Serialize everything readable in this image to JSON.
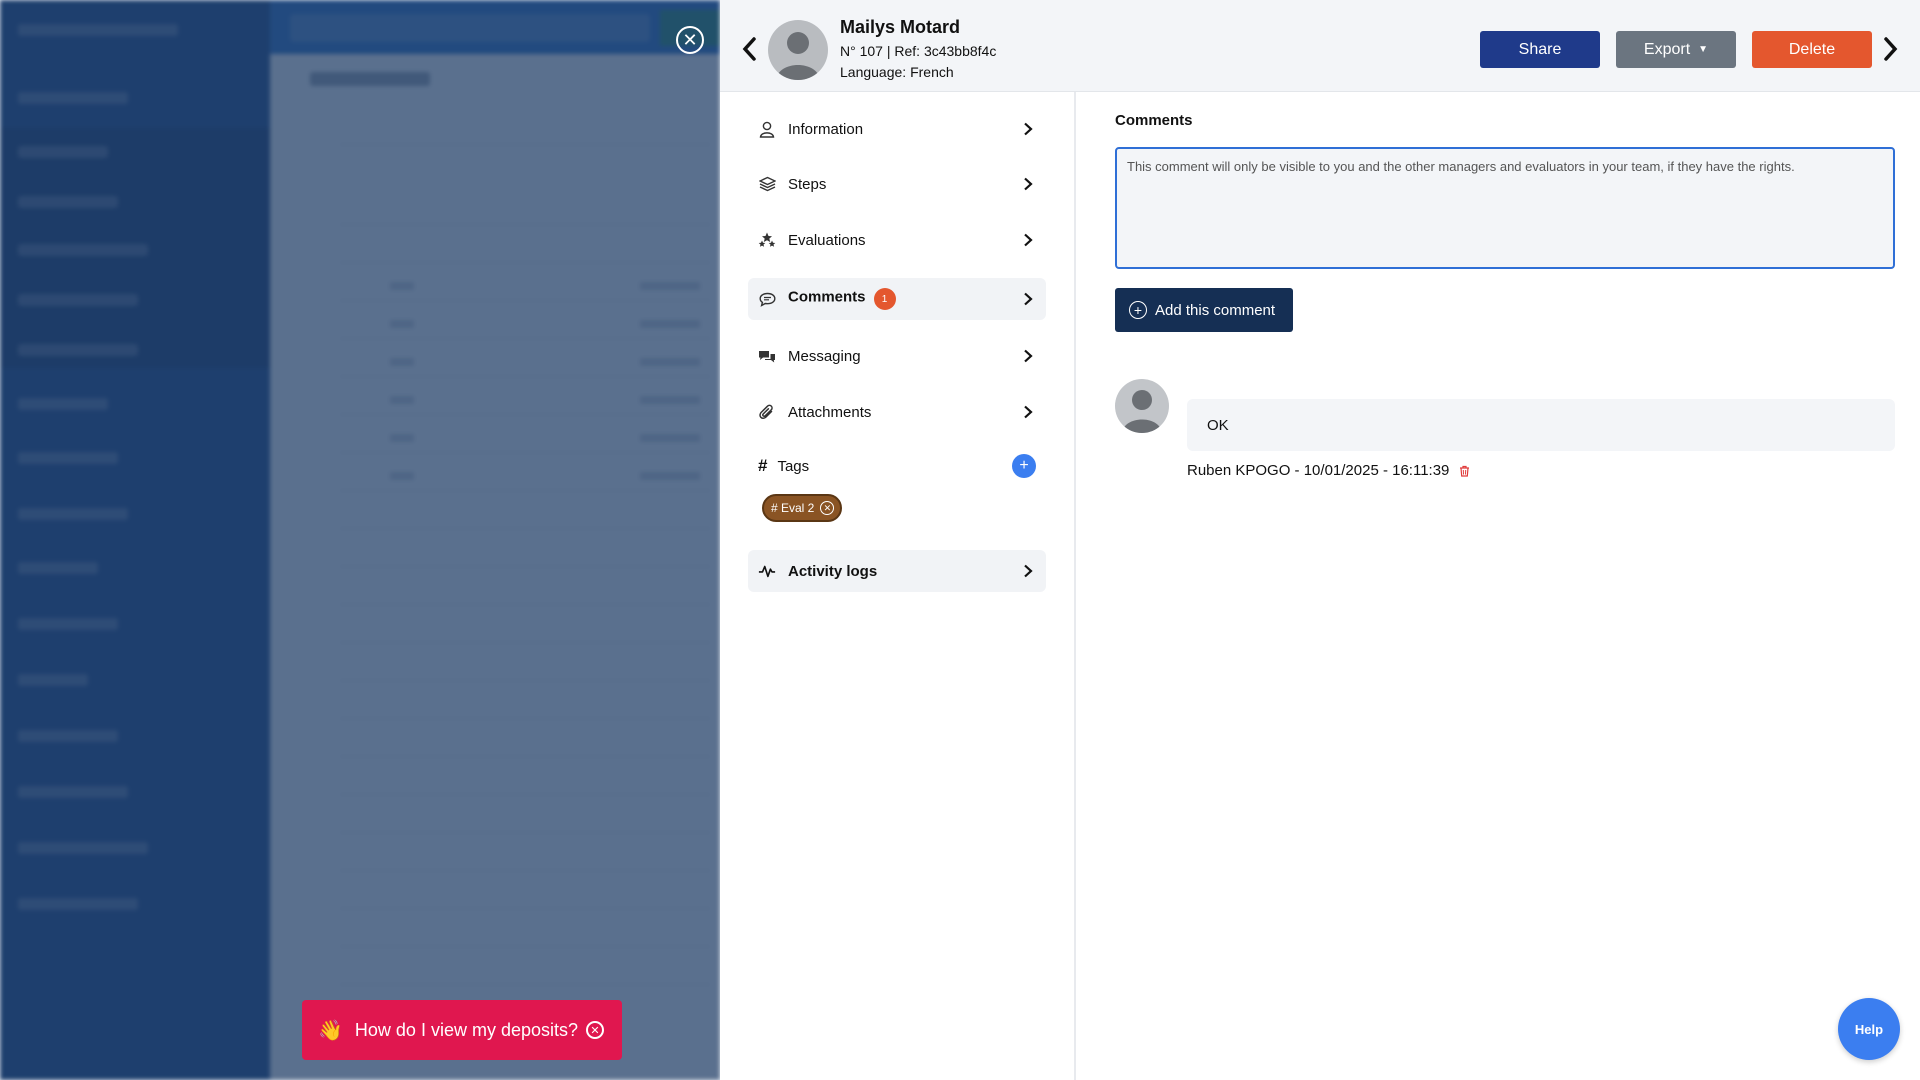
{
  "header": {
    "name": "Mailys Motard",
    "ref_line": "N° 107 | Ref: 3c43bb8f4c",
    "language_line": "Language: French",
    "share_label": "Share",
    "export_label": "Export",
    "delete_label": "Delete"
  },
  "nav": {
    "items": [
      {
        "label": "Information",
        "icon": "user-icon"
      },
      {
        "label": "Steps",
        "icon": "layers-icon"
      },
      {
        "label": "Evaluations",
        "icon": "stars-icon"
      },
      {
        "label": "Comments",
        "icon": "comment-icon",
        "badge": "1",
        "active": true
      },
      {
        "label": "Messaging",
        "icon": "chat-icon"
      },
      {
        "label": "Attachments",
        "icon": "paperclip-icon"
      }
    ],
    "tags_label": "Tags",
    "tag_chip": "# Eval 2",
    "activity_label": "Activity logs"
  },
  "comments": {
    "title": "Comments",
    "placeholder": "This comment will only be visible to you and the other managers and evaluators in your team, if they have the rights.",
    "add_label": "Add this comment",
    "entries": [
      {
        "text": "OK",
        "meta": "Ruben KPOGO - 10/01/2025 - 16:11:39"
      }
    ]
  },
  "toast": {
    "text": "How do I view my deposits?",
    "emoji": "👋"
  },
  "help_label": "Help",
  "colors": {
    "share": "#1f3a8a",
    "export": "#6b7580",
    "delete": "#e4572e",
    "badge": "#e4572e",
    "tag_chip": "#8a5424",
    "add_comment": "#152f54",
    "toast": "#e0174f",
    "help": "#3b7ef0"
  }
}
